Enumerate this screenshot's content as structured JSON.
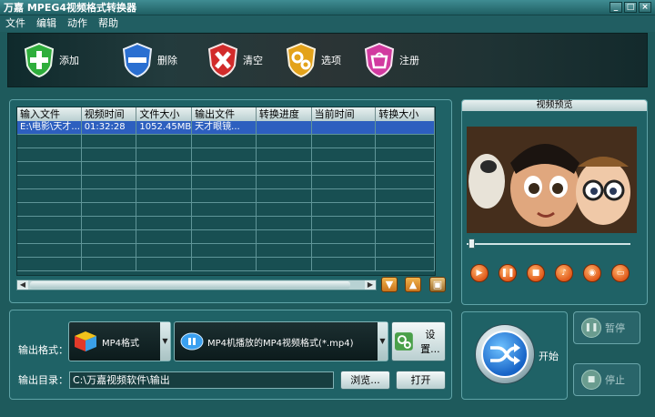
{
  "window": {
    "title": "万嘉 MPEG4视频格式转换器",
    "controls": [
      "_",
      "□",
      "×"
    ]
  },
  "menu": [
    "文件",
    "编辑",
    "动作",
    "帮助"
  ],
  "toolbar": [
    {
      "label": "添加",
      "icon": "add-shield-icon"
    },
    {
      "label": "删除",
      "icon": "remove-shield-icon"
    },
    {
      "label": "清空",
      "icon": "clear-shield-icon"
    },
    {
      "label": "选项",
      "icon": "options-shield-icon"
    },
    {
      "label": "注册",
      "icon": "register-shield-icon"
    }
  ],
  "table": {
    "headers": [
      "输入文件",
      "视频时间",
      "文件大小",
      "输出文件",
      "转换进度",
      "当前时间",
      "转换大小"
    ],
    "rows": [
      [
        "E:\\电影\\天才...",
        "01:32:28",
        "1052.45MB",
        "天才眼镜...",
        "",
        "",
        ""
      ]
    ]
  },
  "preview": {
    "title": "视频预览"
  },
  "output": {
    "format_label": "输出格式：",
    "format_value": "MP4格式",
    "profile_value": "MP4机播放的MP4视频格式(*.mp4)",
    "settings_label": "设置...",
    "dir_label": "输出目录：",
    "dir_value": "C:\\万嘉视频软件\\输出",
    "browse_label": "浏览...",
    "open_label": "打开"
  },
  "actions": {
    "start_label": "开始",
    "pause_label": "暂停",
    "stop_label": "停止"
  },
  "colors": {
    "frame": "#1e5a5c",
    "panel": "#1f6266",
    "selected_row": "#2d5fbf",
    "accent_orange": "#e0591a"
  }
}
